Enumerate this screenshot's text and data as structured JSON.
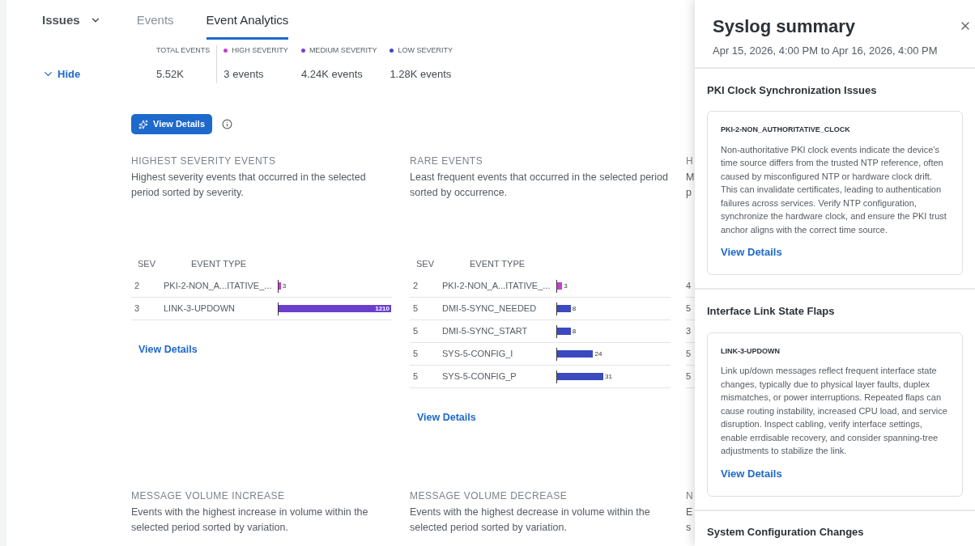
{
  "nav": {
    "issues_menu": "Issues",
    "tabs": [
      {
        "label": "Events",
        "selected": false
      },
      {
        "label": "Event Analytics",
        "selected": true
      }
    ]
  },
  "summary": {
    "hide_label": "Hide",
    "stats": [
      {
        "label": "TOTAL EVENTS",
        "value": "5.52K"
      },
      {
        "label": "HIGH SEVERITY",
        "value": "3 events",
        "color": "#c43fcf"
      },
      {
        "label": "MEDIUM SEVERITY",
        "value": "4.24K events",
        "color": "#7a3fd0"
      },
      {
        "label": "LOW SEVERITY",
        "value": "1.28K events",
        "color": "#3b4abf"
      }
    ]
  },
  "ai_button": "View Details",
  "sections": [
    {
      "title": "HIGHEST SEVERITY EVENTS",
      "description": "Highest severity events that occurred in the selected period sorted by severity.",
      "columns": [
        "SEV",
        "EVENT TYPE"
      ],
      "rows": [
        {
          "sev": "2",
          "event": "PKI-2-NON_A...ITATIVE_...",
          "count": "3",
          "level": 0.02,
          "color": "#c43fcf",
          "label_inside": false
        },
        {
          "sev": "3",
          "event": "LINK-3-UPDOWN",
          "count": "1210",
          "level": 1,
          "color": "#6a3fcc",
          "label_inside": true
        }
      ],
      "link": "View Details"
    },
    {
      "title": "RARE EVENTS",
      "description": "Least frequent events that occurred in the selected period sorted by occurrence.",
      "columns": [
        "SEV",
        "EVENT TYPE"
      ],
      "rows": [
        {
          "sev": "2",
          "event": "PKI-2-NON_A...ITATIVE_...",
          "count": "3",
          "level": 0.045,
          "color": "#c43fcf",
          "label_inside": false
        },
        {
          "sev": "5",
          "event": "DMI-5-SYNC_NEEDED",
          "count": "8",
          "level": 0.12,
          "color": "#3b4abf",
          "label_inside": false
        },
        {
          "sev": "5",
          "event": "DMI-5-SYNC_START",
          "count": "8",
          "level": 0.12,
          "color": "#3b4abf",
          "label_inside": false
        },
        {
          "sev": "5",
          "event": "SYS-5-CONFIG_I",
          "count": "24",
          "level": 0.32,
          "color": "#3b4abf",
          "label_inside": false
        },
        {
          "sev": "5",
          "event": "SYS-5-CONFIG_P",
          "count": "31",
          "level": 0.41,
          "color": "#3b4abf",
          "label_inside": false
        }
      ],
      "link": "View Details"
    }
  ],
  "cut_section": {
    "title": "H",
    "description": "M p",
    "sev": [
      "4",
      "5",
      "3",
      "5",
      "5"
    ]
  },
  "bottom_sections": [
    {
      "title": "MESSAGE VOLUME INCREASE",
      "description": "Events with the highest increase in volume within the selected period sorted by variation."
    },
    {
      "title": "MESSAGE VOLUME DECREASE",
      "description": "Events with the highest decrease in volume within the selected period sorted by variation."
    },
    {
      "title": "N",
      "description": "E s"
    }
  ],
  "panel": {
    "title": "Syslog summary",
    "range": "Apr 15, 2026, 4:00 PM to Apr 16, 2026, 4:00 PM",
    "groups": [
      {
        "heading": "PKI Clock Synchronization Issues",
        "code": "PKI-2-NON_AUTHORITATIVE_CLOCK",
        "text": "Non-authoritative PKI clock events indicate the device’s time source differs from the trusted NTP reference, often caused by misconfigured NTP or hardware clock drift. This can invalidate certificates, leading to authentication failures across services. Verify NTP configuration, synchronize the hardware clock, and ensure the PKI trust anchor aligns with the correct time source.",
        "link": "View Details"
      },
      {
        "heading": "Interface Link State Flaps",
        "code": "LINK-3-UPDOWN",
        "text": "Link up/down messages reflect frequent interface state changes, typically due to physical layer faults, duplex mismatches, or power interruptions. Repeated flaps can cause routing instability, increased CPU load, and service disruption. Inspect cabling, verify interface settings, enable errdisable recovery, and consider spanning-tree adjustments to stabilize the link.",
        "link": "View Details"
      },
      {
        "heading": "System Configuration Changes"
      }
    ]
  }
}
